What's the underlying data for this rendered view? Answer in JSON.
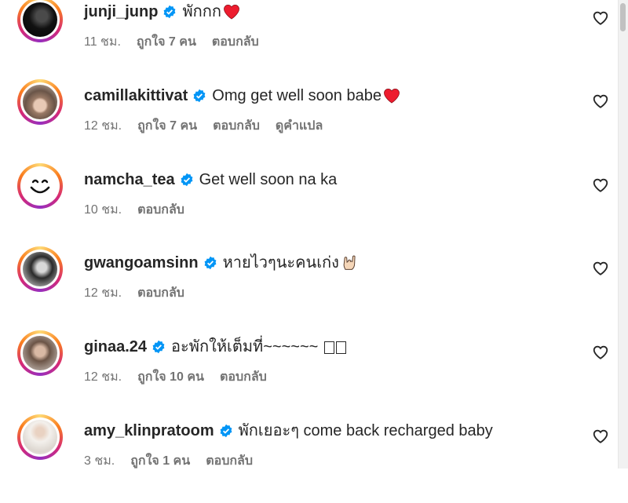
{
  "comments": [
    {
      "username": "junji_junp",
      "text": "พักกก",
      "emoji": "heart",
      "time": "11 ชม.",
      "likes": "ถูกใจ 7 คน",
      "reply": "ตอบกลับ",
      "translate": ""
    },
    {
      "username": "camillakittivat",
      "text": "Omg get well soon babe",
      "emoji": "heart",
      "time": "12 ชม.",
      "likes": "ถูกใจ 7 คน",
      "reply": "ตอบกลับ",
      "translate": "ดูคำแปล"
    },
    {
      "username": "namcha_tea",
      "text": "Get well soon na ka",
      "emoji": "",
      "time": "10 ชม.",
      "likes": "",
      "reply": "ตอบกลับ",
      "translate": ""
    },
    {
      "username": "gwangoamsinn",
      "text": "หายไวๆนะคนเก่ง",
      "emoji": "rock-hand",
      "time": "12 ชม.",
      "likes": "",
      "reply": "ตอบกลับ",
      "translate": ""
    },
    {
      "username": "ginaa.24",
      "text": "อะพักให้เต็มที่~~~~~~",
      "emoji": "tofu",
      "time": "12 ชม.",
      "likes": "ถูกใจ 10 คน",
      "reply": "ตอบกลับ",
      "translate": ""
    },
    {
      "username": "amy_klinpratoom",
      "text": "พักเยอะๆ come back recharged baby",
      "emoji": "",
      "time": "3 ชม.",
      "likes": "ถูกใจ 1 คน",
      "reply": "ตอบกลับ",
      "translate": ""
    }
  ],
  "colors": {
    "verified": "#0095f6",
    "heart": "#ed1c2e",
    "meta": "#737373",
    "text": "#262626"
  },
  "icons": {
    "verified": "verified-badge-icon",
    "like": "heart-outline-icon"
  }
}
